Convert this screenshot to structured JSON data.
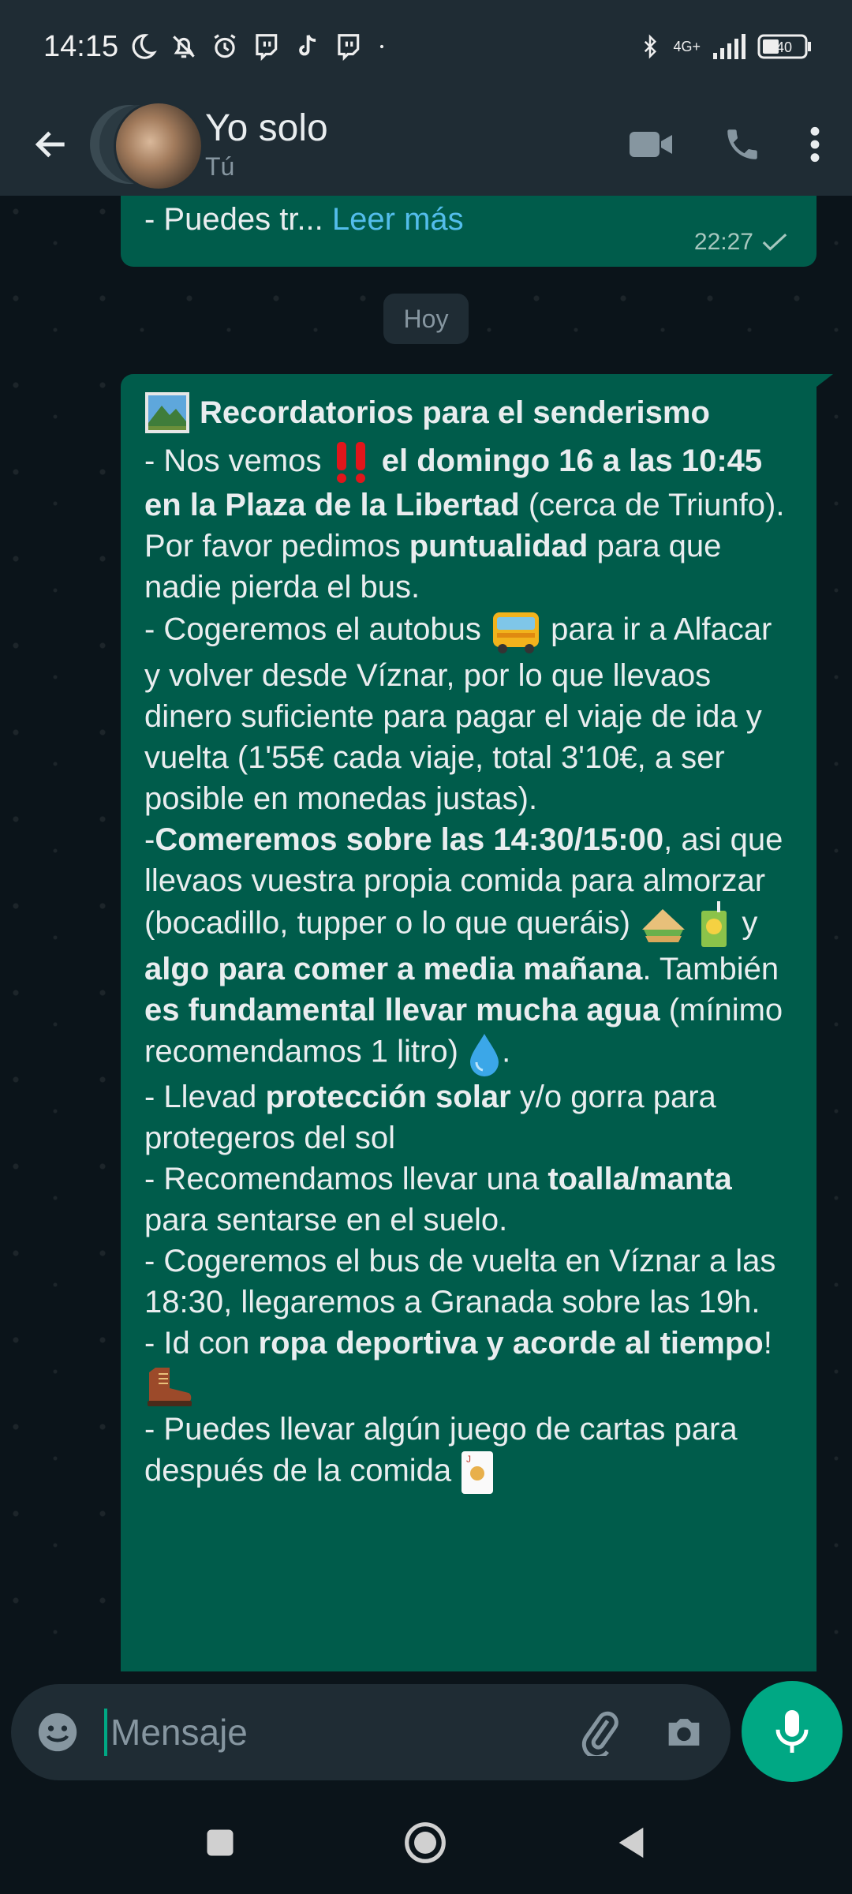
{
  "status_bar": {
    "time": "14:15",
    "network": "4G+",
    "battery": "40"
  },
  "header": {
    "contact_name": "Yo solo",
    "contact_subtitle": "Tú"
  },
  "previous_message": {
    "text": "- Puedes tr...",
    "read_more": "Leer más",
    "time": "22:27"
  },
  "date_chip": "Hoy",
  "message": {
    "title": "Recordatorios para el senderismo",
    "p1": {
      "a": "- Nos vemos",
      "b": "el domingo 16 a las 10:45 en la Plaza de la Libertad",
      "c": "(cerca de Triunfo). Por favor pedimos",
      "d": "puntualidad",
      "e": "para que nadie pierda el bus."
    },
    "p2": {
      "a": "- Cogeremos el autobus",
      "b": "para ir a Alfacar y volver desde Víznar, por lo que llevaos dinero suficiente para pagar el viaje de ida y vuelta (1'55€ cada viaje, total 3'10€, a ser posible en monedas justas)."
    },
    "p3": {
      "a": "-",
      "b": "Comeremos sobre las 14:30/15:00",
      "c": ", asi que llevaos vuestra propia comida para almorzar (bocadillo, tupper o lo que queráis)",
      "d": "y",
      "e": "algo para comer a media mañana",
      "f": ". También",
      "g": "es fundamental llevar mucha agua",
      "h": "(mínimo recomendamos 1 litro)",
      "i": "."
    },
    "p4": {
      "a": "- Llevad",
      "b": "protección solar",
      "c": "y/o gorra para protegeros del sol"
    },
    "p5": {
      "a": "- Recomendamos llevar una",
      "b": "toalla/manta",
      "c": "para sentarse en el suelo."
    },
    "p6": {
      "a": "-  Cogeremos el bus de vuelta en Víznar a las 18:30, llegaremos a Granada sobre las 19h."
    },
    "p7": {
      "a": "- Id con",
      "b": "ropa deportiva y acorde al tiempo",
      "c": "!"
    },
    "p8": {
      "a": "- Puedes llevar algún juego de cartas para después de la comida"
    }
  },
  "composer": {
    "placeholder": "Mensaje"
  },
  "colors": {
    "bubble_out": "#005c4b",
    "accent": "#00a884",
    "header": "#1f2c34",
    "link": "#53bdeb"
  }
}
